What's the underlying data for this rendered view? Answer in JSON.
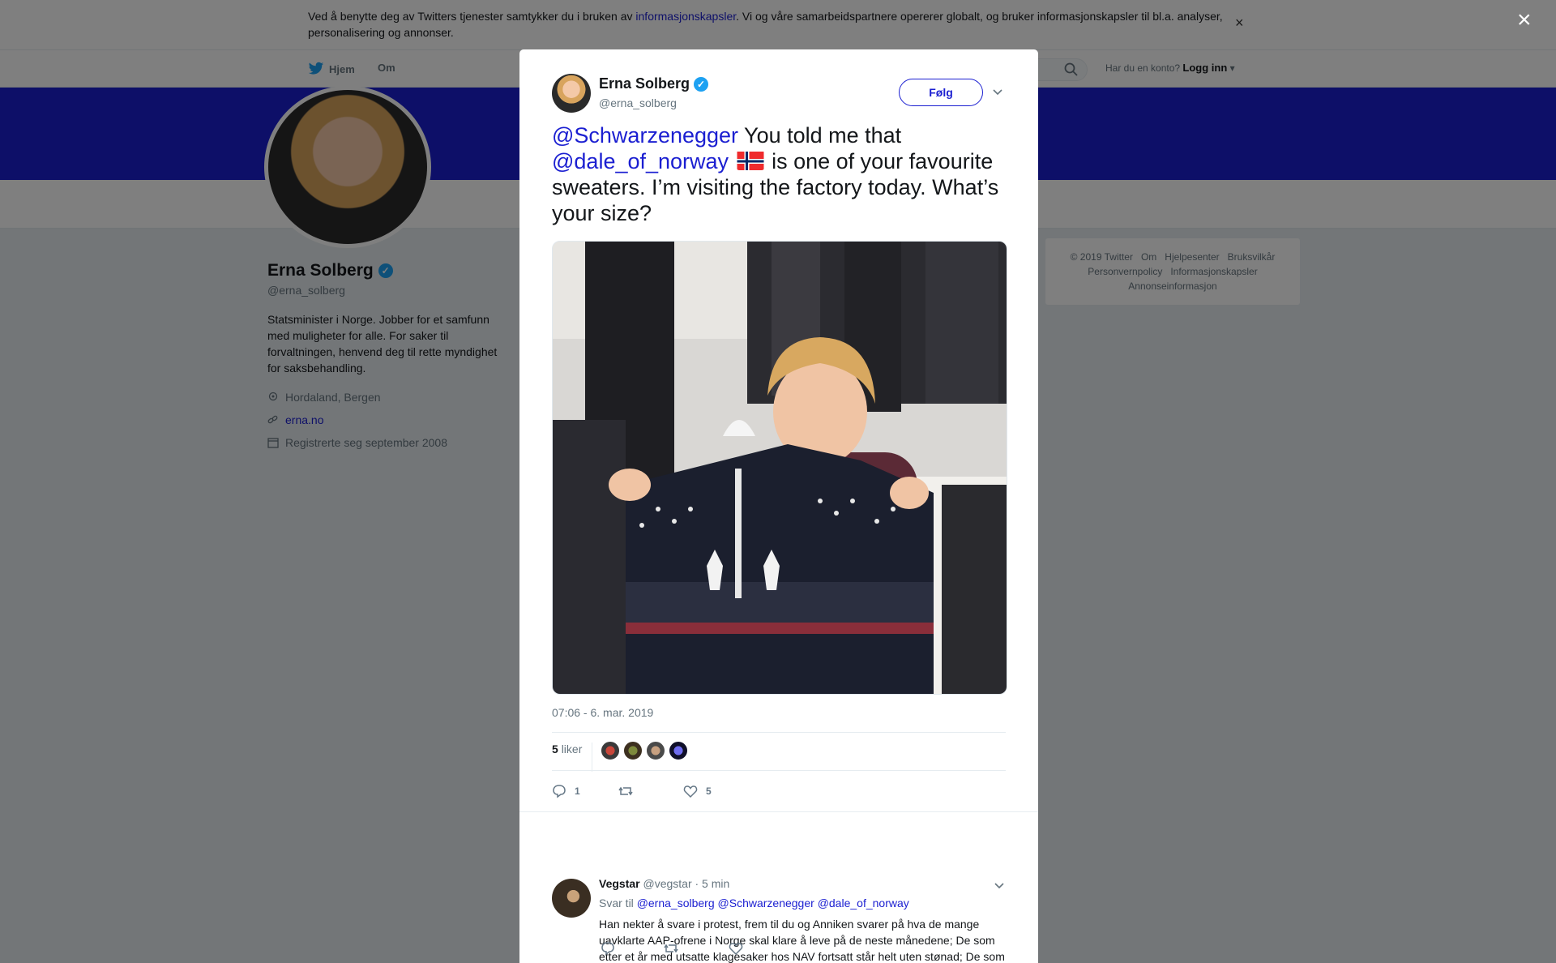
{
  "cookie": {
    "text_before": "Ved å benytte deg av Twitters tjenester samtykker du i bruken av ",
    "link": "informasjonskapsler",
    "text_after": ". Vi og våre samarbeidspartnere opererer globalt, og bruker informasjonskapsler til bl.a. analyser, personalisering og annonser.",
    "close": "×"
  },
  "nav": {
    "home": "Hjem",
    "about": "Om",
    "have_account": "Har du en konto?",
    "login": "Logg inn"
  },
  "profile": {
    "name": "Erna Solberg",
    "handle": "@erna_solberg",
    "bio": "Statsminister i Norge. Jobber for et samfunn med muligheter for alle. For saker til forvaltningen, henvend deg til rette myndighet for saksbehandling.",
    "location": "Hordaland, Bergen",
    "website": "erna.no",
    "joined": "Registrerte seg september 2008"
  },
  "footer": {
    "row1": [
      "© 2019 Twitter",
      "Om",
      "Hjelpesenter",
      "Bruksvilkår"
    ],
    "row2": [
      "Personvernpolicy",
      "Informasjonskapsler"
    ],
    "row3": [
      "Annonseinformasjon"
    ]
  },
  "overlay": {
    "close": "×"
  },
  "tweet": {
    "author_name": "Erna Solberg",
    "author_handle": "@erna_solberg",
    "follow": "Følg",
    "mention1": "@Schwarzenegger",
    "text1": " You told me that ",
    "mention2": "@dale_of_norway",
    "text2": " is one of your favourite sweaters. I’m visiting the factory today. What’s your size?",
    "time": "07:06 - 6. mar. 2019",
    "likes_count": "5",
    "likes_label": "liker",
    "reply_count": "1",
    "like_count": "5"
  },
  "reply": {
    "name": "Vegstar",
    "handle": "@vegstar",
    "time": "· 5 min",
    "reply_to_label": "Svar til",
    "reply_to": [
      "@erna_solberg",
      "@Schwarzenegger",
      "@dale_of_norway"
    ],
    "text": "Han nekter å svare i protest, frem til du og Anniken svarer på hva de mange uavklarte AAP-ofrene i Norge skal klare å leve på de neste månedene; De som etter et år med utsatte klagesaker hos NAV fortsatt står helt uten stønad; De som ikke kan ta opp flere lån; De dere ignorerer."
  },
  "colors": {
    "link": "#1b1fd1",
    "banner": "#1b1fd1",
    "verified": "#1da1f2"
  }
}
